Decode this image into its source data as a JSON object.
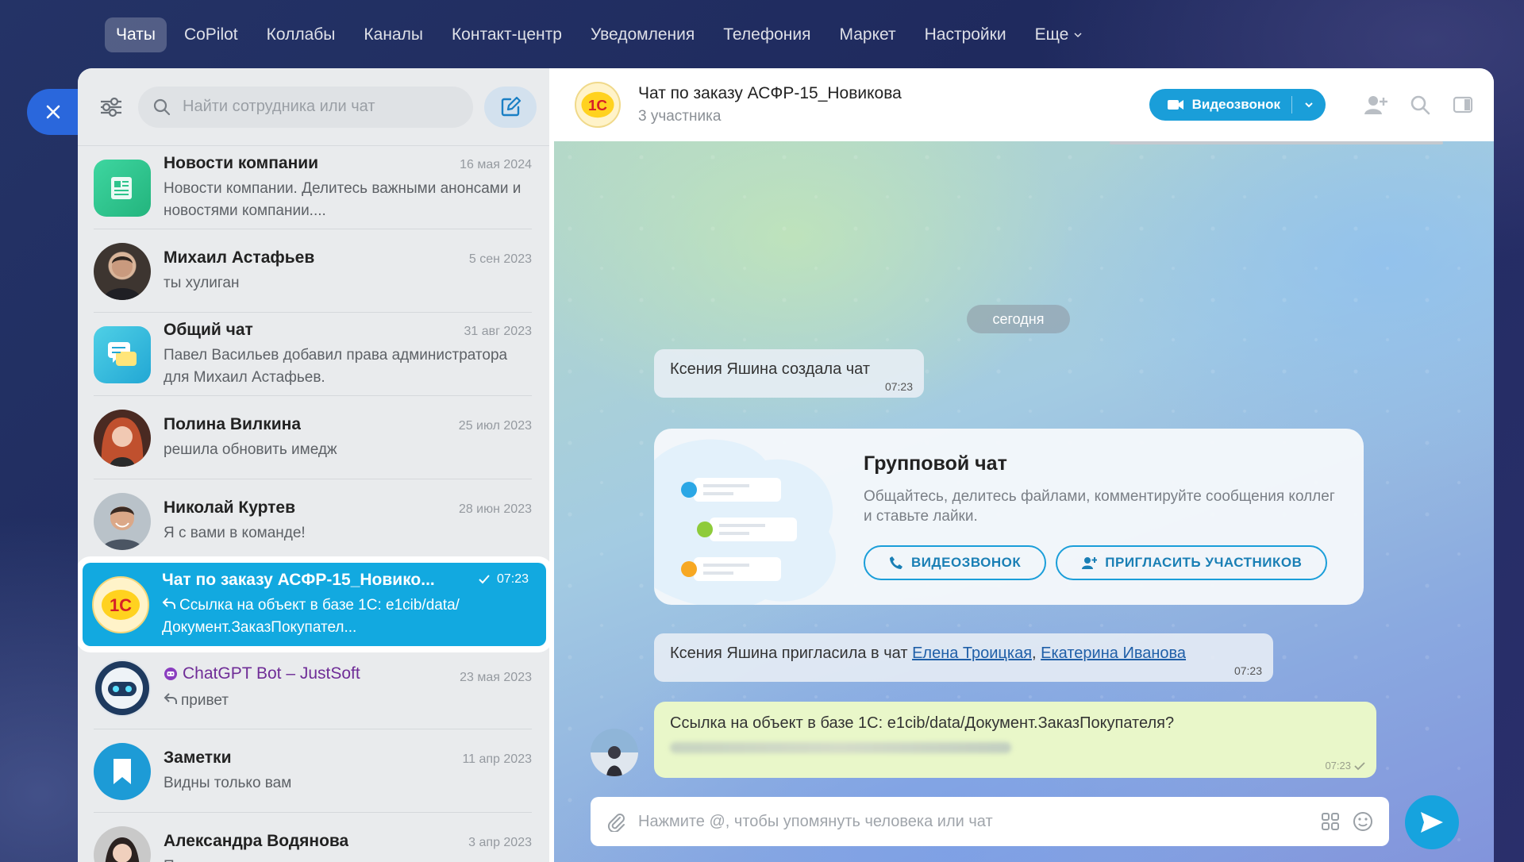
{
  "topnav": {
    "items": [
      "Чаты",
      "CoPilot",
      "Коллабы",
      "Каналы",
      "Контакт-центр",
      "Уведомления",
      "Телефония",
      "Маркет",
      "Настройки",
      "Еще"
    ]
  },
  "sidebar": {
    "search_placeholder": "Найти сотрудника или чат",
    "chats": [
      {
        "name": "Новости компании",
        "date": "16 мая 2024",
        "preview": "Новости компании. Делитесь важными анонсами и новостями компании...."
      },
      {
        "name": "Михаил Астафьев",
        "date": "5 сен 2023",
        "preview": "ты хулиган"
      },
      {
        "name": "Общий чат",
        "date": "31 авг 2023",
        "preview": "Павел Васильев добавил права администратора для Михаил Астафьев."
      },
      {
        "name": "Полина Вилкина",
        "date": "25 июл 2023",
        "preview": "решила обновить имедж"
      },
      {
        "name": "Николай Куртев",
        "date": "28 июн 2023",
        "preview": "Я с вами в команде!"
      },
      {
        "name": "Чат по заказу АСФР-15_Новико...",
        "date": "07:23",
        "preview": "Ссылка на объект в базе 1С: e1cib/data/Документ.ЗаказПокупател..."
      },
      {
        "name": "ChatGPT Bot – JustSoft",
        "date": "23 мая 2023",
        "preview": "привет"
      },
      {
        "name": "Заметки",
        "date": "11 апр 2023",
        "preview": "Видны только вам"
      },
      {
        "name": "Александра Водянова",
        "date": "3 апр 2023",
        "preview": "Пользователь..."
      }
    ]
  },
  "chat": {
    "title": "Чат по заказу АСФР-15_Новикова",
    "subtitle": "3 участника",
    "video_label": "Видеозвонок",
    "date_pill": "сегодня",
    "sys1_text": "Ксения Яшина создала чат",
    "sys1_time": "07:23",
    "card_title": "Групповой чат",
    "card_desc": "Общайтесь, делитесь файлами, комментируйте сообщения коллег и ставьте лайки.",
    "card_btn_video": "ВИДЕОЗВОНОК",
    "card_btn_invite": "ПРИГЛАСИТЬ УЧАСТНИКОВ",
    "sys2_prefix": "Ксения Яшина пригласила в чат ",
    "sys2_link1": "Елена Троицкая",
    "sys2_sep": ", ",
    "sys2_link2": "Екатерина Иванова",
    "sys2_time": "07:23",
    "msg_text": "Ссылка на объект в базе 1С: e1cib/data/Документ.ЗаказПокупателя?",
    "msg_time": "07:23",
    "composer_placeholder": "Нажмите @, чтобы упомянуть человека или чат",
    "logo_text": "1С"
  },
  "colors": {
    "accent": "#12a9e0",
    "close_button": "#2a67dc",
    "bot_name": "#6f2d97",
    "my_message": "#e9f7c9"
  }
}
